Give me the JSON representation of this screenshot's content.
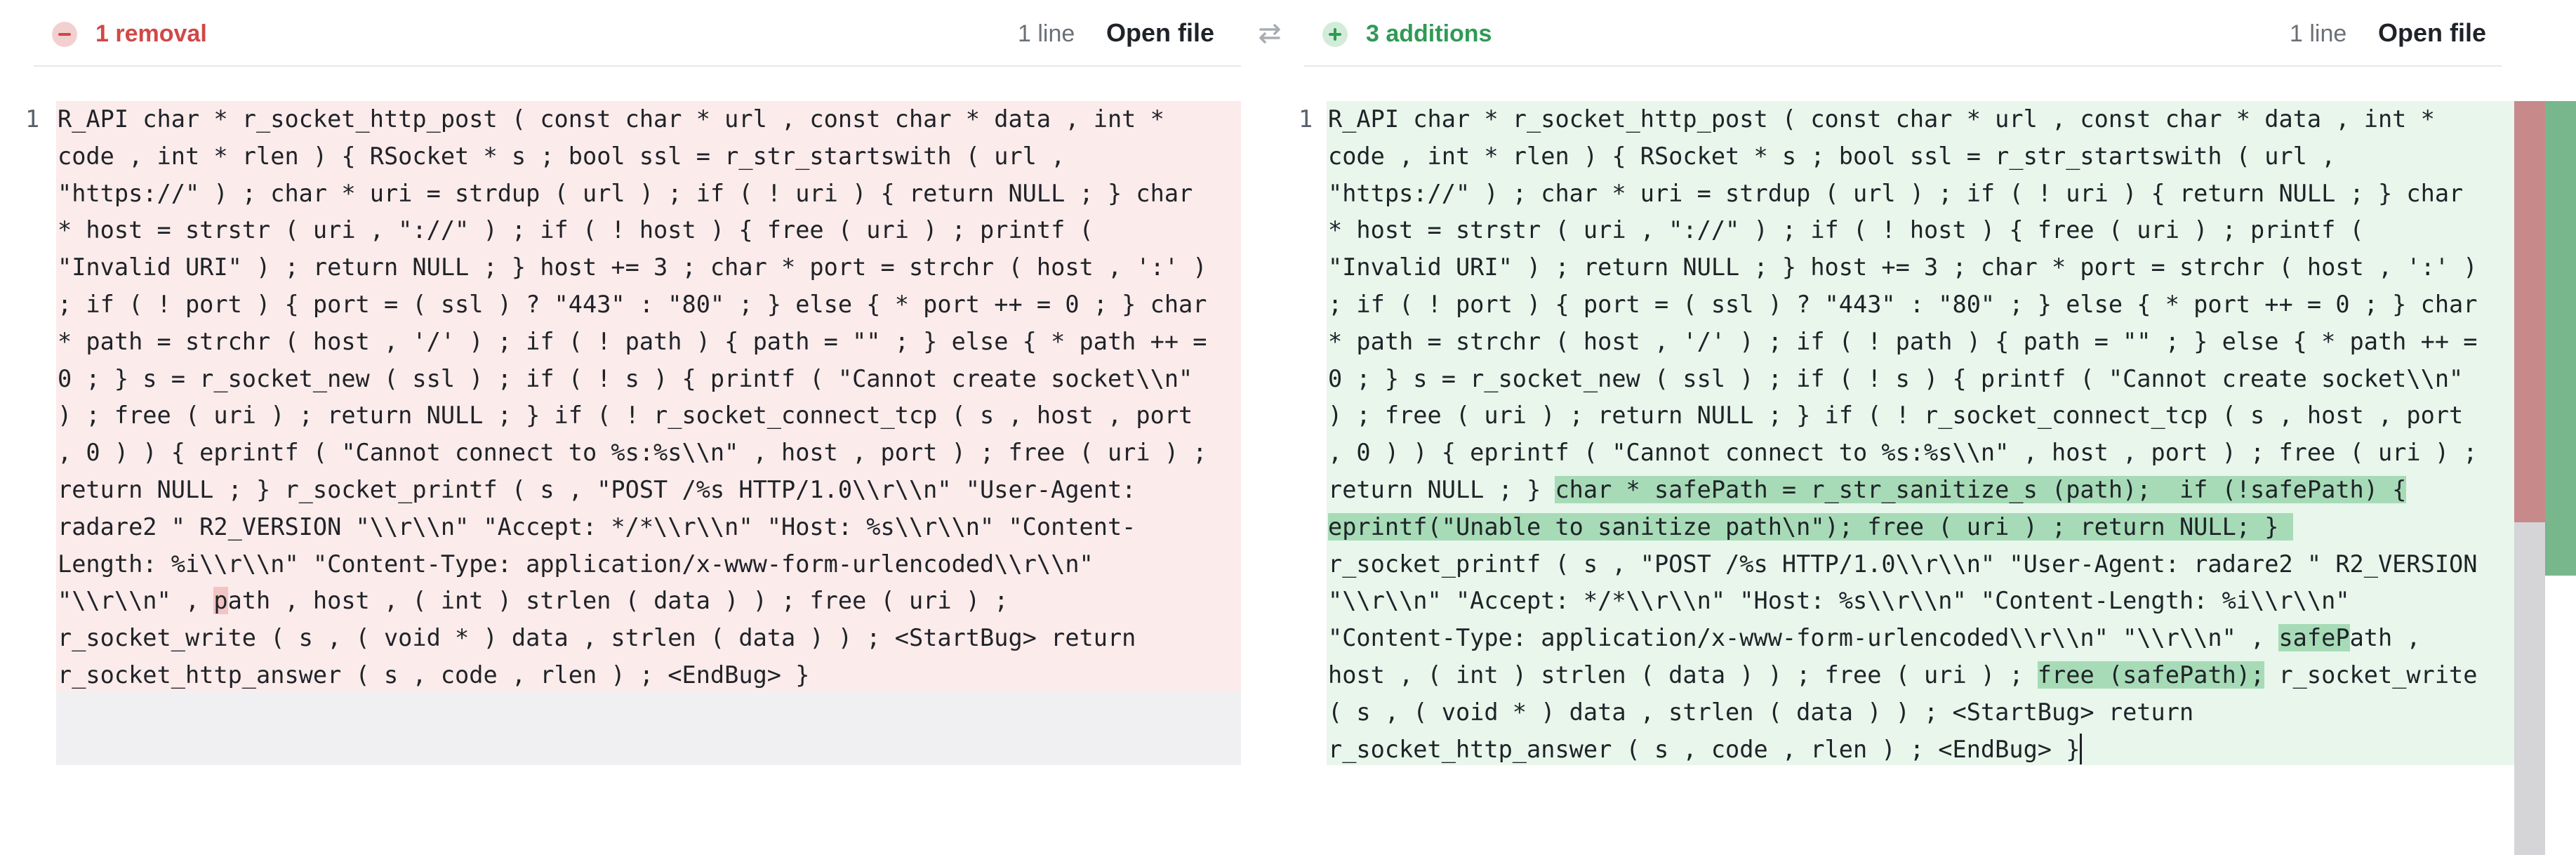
{
  "left_pane": {
    "title": "1 removal",
    "line_count": "1 line",
    "open_file": "Open file",
    "line_number": "1",
    "code": {
      "part1": "R_API char * r_socket_http_post ( const char * url , const char * data , int *\ncode , int * rlen ) { RSocket * s ; bool ssl = r_str_startswith ( url ,\n\"https://\" ) ; char * uri = strdup ( url ) ; if ( ! uri ) { return NULL ; } char\n* host = strstr ( uri , \"://\" ) ; if ( ! host ) { free ( uri ) ; printf (\n\"Invalid URI\" ) ; return NULL ; } host += 3 ; char * port = strchr ( host , ':' )\n; if ( ! port ) { port = ( ssl ) ? \"443\" : \"80\" ; } else { * port ++ = 0 ; } char\n* path = strchr ( host , '/' ) ; if ( ! path ) { path = \"\" ; } else { * path ++ =\n0 ; } s = r_socket_new ( ssl ) ; if ( ! s ) { printf ( \"Cannot create socket\\\\n\"\n) ; free ( uri ) ; return NULL ; } if ( ! r_socket_connect_tcp ( s , host , port\n, 0 ) ) { eprintf ( \"Cannot connect to %s:%s\\\\n\" , host , port ) ; free ( uri ) ;\nreturn NULL ; } r_socket_printf ( s , \"POST /%s HTTP/1.0\\\\r\\\\n\" \"User-Agent:\nradare2 \" R2_VERSION \"\\\\r\\\\n\" \"Accept: */*\\\\r\\\\n\" \"Host: %s\\\\r\\\\n\" \"Content-\nLength: %i\\\\r\\\\n\" \"Content-Type: application/x-www-form-urlencoded\\\\r\\\\n\"\n\"\\\\r\\\\n\" , ",
      "deleted": "p",
      "part2": "ath , host , ( int ) strlen ( data ) ) ; free ( uri ) ;\nr_socket_write ( s , ( void * ) data , strlen ( data ) ) ; <StartBug> return\nr_socket_http_answer ( s , code , rlen ) ; <EndBug> }"
    }
  },
  "right_pane": {
    "title": "3 additions",
    "line_count": "1 line",
    "open_file": "Open file",
    "line_number": "1",
    "code": {
      "part1": "R_API char * r_socket_http_post ( const char * url , const char * data , int *\ncode , int * rlen ) { RSocket * s ; bool ssl = r_str_startswith ( url ,\n\"https://\" ) ; char * uri = strdup ( url ) ; if ( ! uri ) { return NULL ; } char\n* host = strstr ( uri , \"://\" ) ; if ( ! host ) { free ( uri ) ; printf (\n\"Invalid URI\" ) ; return NULL ; } host += 3 ; char * port = strchr ( host , ':' )\n; if ( ! port ) { port = ( ssl ) ? \"443\" : \"80\" ; } else { * port ++ = 0 ; } char\n* path = strchr ( host , '/' ) ; if ( ! path ) { path = \"\" ; } else { * path ++ =\n0 ; } s = r_socket_new ( ssl ) ; if ( ! s ) { printf ( \"Cannot create socket\\\\n\"\n) ; free ( uri ) ; return NULL ; } if ( ! r_socket_connect_tcp ( s , host , port\n, 0 ) ) { eprintf ( \"Cannot connect to %s:%s\\\\n\" , host , port ) ; free ( uri ) ;\nreturn NULL ; } ",
      "added1": "char * safePath = r_str_sanitize_s (path);  if (!safePath) {\neprintf(\"Unable to sanitize path\\n\"); free ( uri ) ; return NULL; } ",
      "part2": "\nr_socket_printf ( s , \"POST /%s HTTP/1.0\\\\r\\\\n\" \"User-Agent: radare2 \" R2_VERSION\n\"\\\\r\\\\n\" \"Accept: */*\\\\r\\\\n\" \"Host: %s\\\\r\\\\n\" \"Content-Length: %i\\\\r\\\\n\"\n\"Content-Type: application/x-www-form-urlencoded\\\\r\\\\n\" \"\\\\r\\\\n\" , ",
      "added2": "safeP",
      "part3": "ath ,\nhost , ( int ) strlen ( data ) ) ; free ( uri ) ; ",
      "added3": "free (safePath);",
      "part4": " r_socket_write\n( s , ( void * ) data , strlen ( data ) ) ; <StartBug> return\nr_socket_http_answer ( s , code , rlen ) ; <EndBug> }"
    }
  },
  "colors": {
    "removal_accent": "#d04848",
    "addition_accent": "#2f9a55",
    "removed_bg": "#fcebeb",
    "added_bg": "#e8f6ec"
  },
  "icons": [
    "minus-circle-icon",
    "plus-circle-icon",
    "swap-arrows-icon"
  ]
}
